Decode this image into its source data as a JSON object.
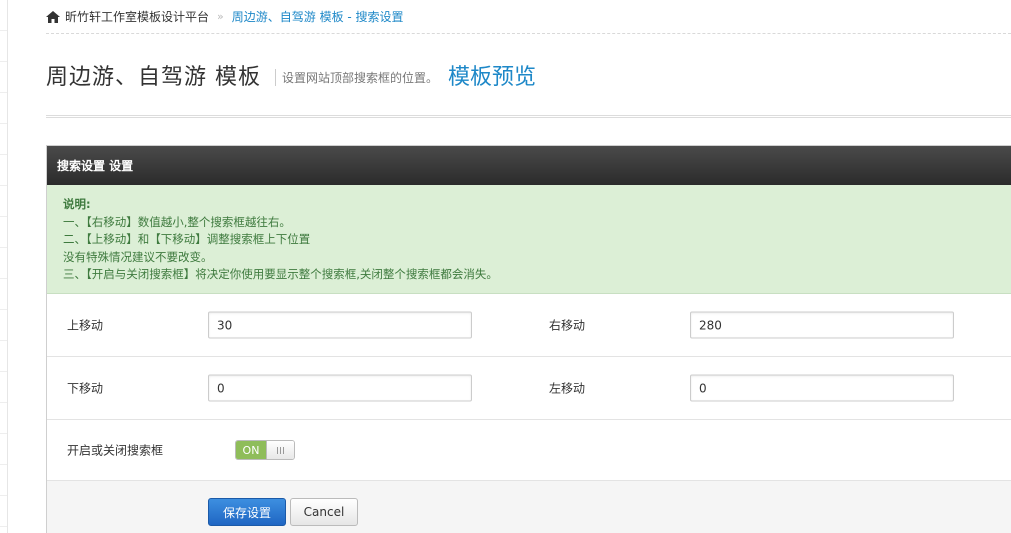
{
  "breadcrumb": {
    "home_icon": "home-icon",
    "home": "昕竹轩工作室模板设计平台",
    "separator": "»",
    "current": "周边游、自驾游 模板 - 搜索设置"
  },
  "header": {
    "title": "周边游、自驾游 模板",
    "subtitle": "设置网站顶部搜索框的位置。",
    "preview_link": "模板预览"
  },
  "panel": {
    "title": "搜索设置 设置",
    "note": {
      "title": "说明:",
      "lines": [
        "一、【右移动】数值越小,整个搜索框越往右。",
        "二、【上移动】和【下移动】调整搜索框上下位置",
        "没有特殊情况建议不要改变。",
        "三、【开启与关闭搜索框】将决定你使用要显示整个搜索框,关闭整个搜索框都会消失。"
      ]
    },
    "fields": {
      "up_label": "上移动",
      "up_value": "30",
      "right_label": "右移动",
      "right_value": "280",
      "down_label": "下移动",
      "down_value": "0",
      "left_label": "左移动",
      "left_value": "0"
    },
    "toggle": {
      "label": "开启或关闭搜索框",
      "state_text": "ON",
      "on": true
    },
    "actions": {
      "save": "保存设置",
      "cancel": "Cancel"
    }
  },
  "colors": {
    "link": "#1e88c8",
    "note_bg": "#dcefd6",
    "note_text": "#3e7a3e",
    "panel_header": "#333333",
    "toggle_on": "#8fbd5a",
    "primary_button": "#2a74d0"
  }
}
